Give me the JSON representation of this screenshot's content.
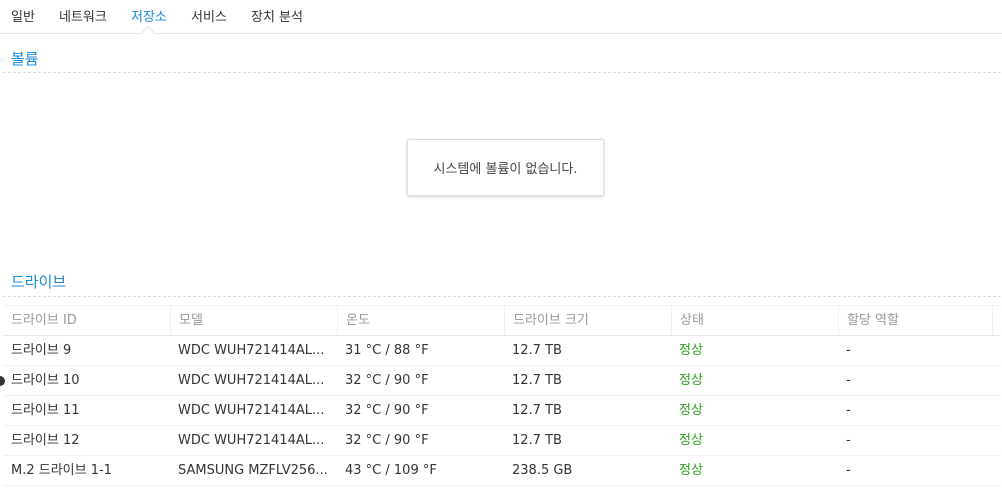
{
  "tabs": [
    "일반",
    "네트워크",
    "저장소",
    "서비스",
    "장치 분석"
  ],
  "active_tab": "저장소",
  "volume_section": {
    "title": "볼륨",
    "empty_message": "시스템에 볼륨이 없습니다."
  },
  "drive_section": {
    "title": "드라이브",
    "columns": [
      "드라이브 ID",
      "모델",
      "온도",
      "드라이브 크기",
      "상태",
      "할당 역할"
    ],
    "rows": [
      {
        "id": "드라이브 9",
        "model": "WDC WUH721414AL...",
        "temp": "31 °C / 88 °F",
        "size": "12.7 TB",
        "status": "정상",
        "role": "-"
      },
      {
        "id": "드라이브 10",
        "model": "WDC WUH721414AL...",
        "temp": "32 °C / 90 °F",
        "size": "12.7 TB",
        "status": "정상",
        "role": "-"
      },
      {
        "id": "드라이브 11",
        "model": "WDC WUH721414AL...",
        "temp": "32 °C / 90 °F",
        "size": "12.7 TB",
        "status": "정상",
        "role": "-"
      },
      {
        "id": "드라이브 12",
        "model": "WDC WUH721414AL...",
        "temp": "32 °C / 90 °F",
        "size": "12.7 TB",
        "status": "정상",
        "role": "-"
      },
      {
        "id": "M.2 드라이브 1-1",
        "model": "SAMSUNG MZFLV256...",
        "temp": "43 °C / 109 °F",
        "size": "238.5 GB",
        "status": "정상",
        "role": "-"
      }
    ]
  },
  "colors": {
    "accent": "#1a8bd6",
    "status_ok": "#2f9e1f"
  }
}
